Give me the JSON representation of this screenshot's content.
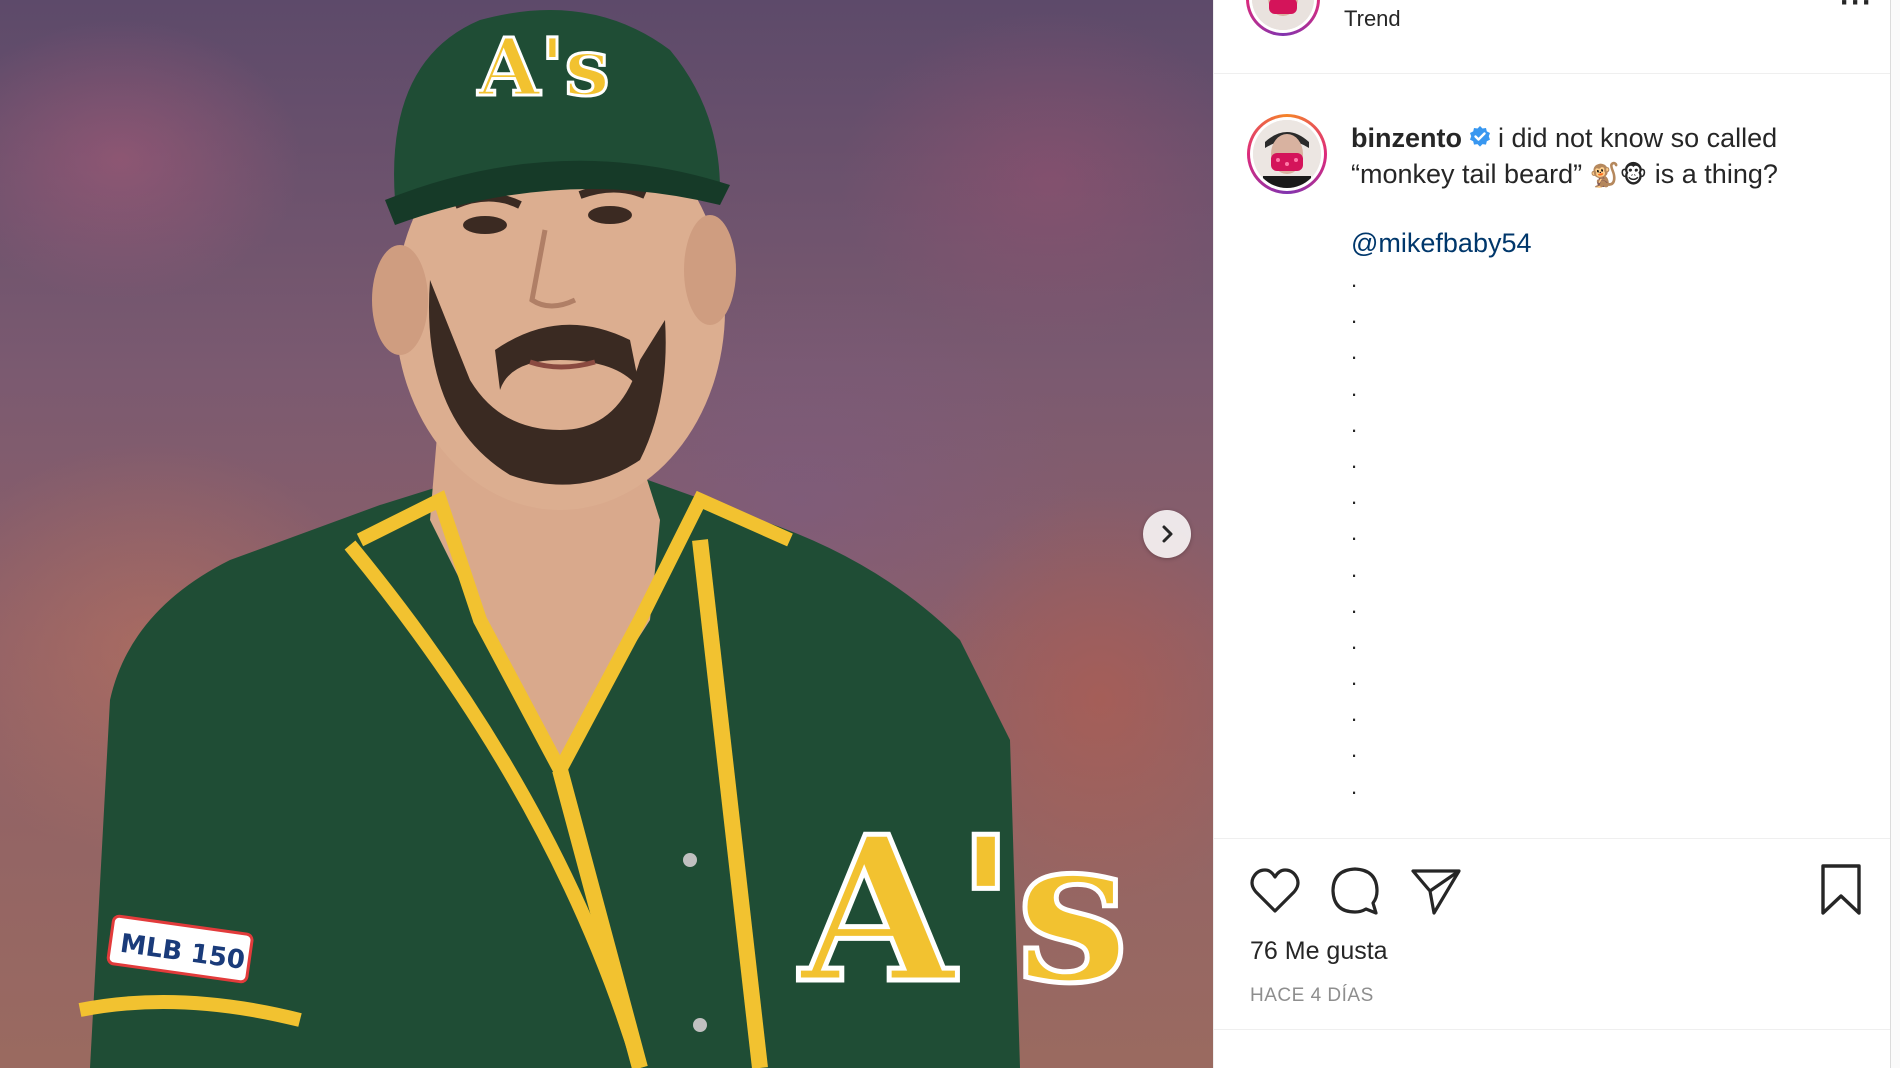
{
  "post": {
    "header_label": "Trend",
    "username": "binzento",
    "caption_line1": "i did not know so called",
    "caption_line2_pre": "“monkey tail beard”",
    "caption_emoji": "🐒🐵",
    "caption_line2_post": "is a thing?",
    "mention": "@mikefbaby54",
    "dot": ".",
    "dot_count": 15,
    "likes": "76 Me gusta",
    "timestamp": "HACE 4 DÍAS",
    "jersey_logo": "A's",
    "patch_text": "MLB 150"
  },
  "icons": {
    "like": "heart-icon",
    "comment": "comment-icon",
    "share": "send-icon",
    "save": "bookmark-icon",
    "next": "chevron-right-icon",
    "more": "more-options-icon",
    "verified": "verified-badge-icon"
  },
  "colors": {
    "verified_blue": "#3897f0",
    "mention_blue": "#00376b",
    "text": "#262626",
    "muted": "#8e8e8e",
    "jersey_green": "#1f4d35",
    "jersey_gold": "#f2c230"
  }
}
